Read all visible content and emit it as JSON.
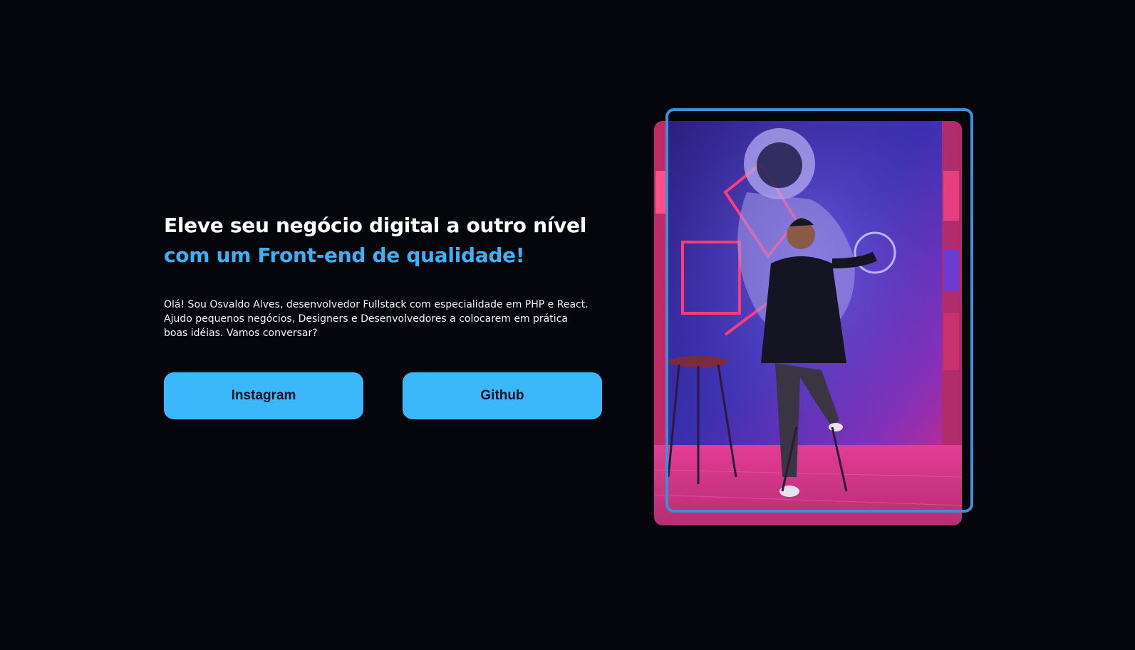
{
  "hero": {
    "headline_white": "Eleve seu negócio digital a outro nível",
    "headline_accent": "com um Front-end de qualidade!",
    "intro": "Olá! Sou Osvaldo Alves, desenvolvedor Fullstack com especialidade em PHP e React. Ajudo pequenos negócios, Designers e Desenvolvedores a colocarem em prática boas idéias. Vamos conversar?"
  },
  "buttons": {
    "instagram_label": "Instagram",
    "github_label": "Github"
  },
  "colors": {
    "background": "#05060b",
    "accent": "#3bb2f6",
    "button": "#3bb7fb",
    "frame": "#3d8fd6"
  },
  "photo": {
    "alt": "Osvaldo Alves"
  }
}
